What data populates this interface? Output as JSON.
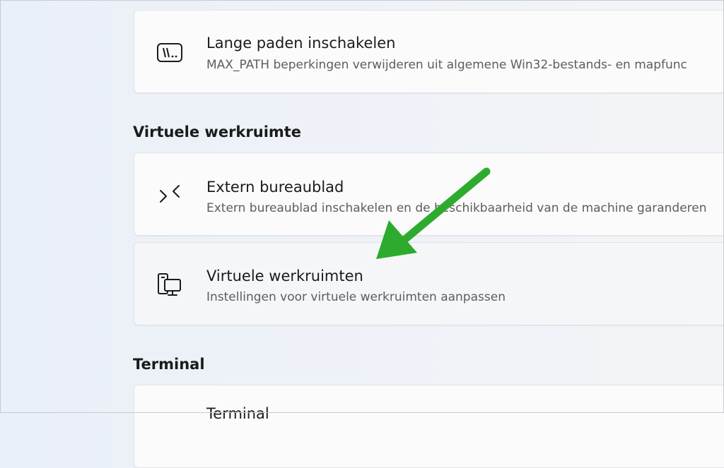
{
  "cards": {
    "long_paths": {
      "title": "Lange paden inschakelen",
      "description": "MAX_PATH beperkingen verwijderen uit algemene Win32-bestands- en mapfunc"
    },
    "remote_desktop": {
      "title": "Extern bureaublad",
      "description": "Extern bureaublad inschakelen en de beschikbaarheid van de machine garanderen"
    },
    "virtual_workspaces": {
      "title": "Virtuele werkruimten",
      "description": "Instellingen voor virtuele werkruimten aanpassen"
    },
    "terminal": {
      "title": "Terminal"
    }
  },
  "sections": {
    "virtual_workspace": "Virtuele werkruimte",
    "terminal": "Terminal"
  },
  "icons": {
    "long_paths": "long-path-icon",
    "remote_desktop": "remote-desktop-icon",
    "virtual_workspaces": "virtual-workspaces-icon"
  },
  "colors": {
    "annotation_arrow": "#2eab2e"
  }
}
